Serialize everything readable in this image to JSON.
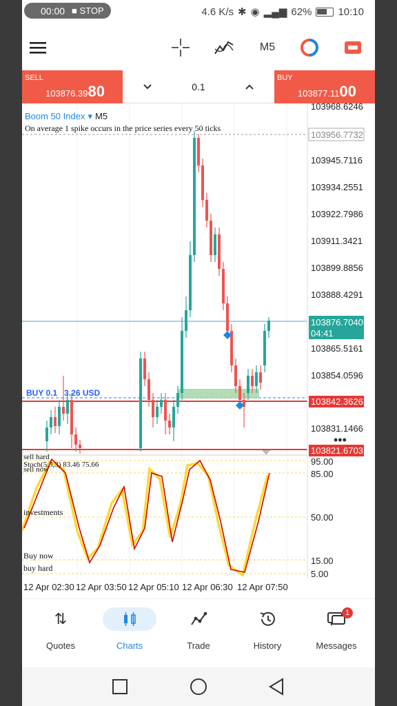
{
  "status_bar": {
    "rec_time": "00:00",
    "rec_stop": "STOP",
    "net_speed": "4.6 K/s",
    "icons": [
      "bluetooth-icon",
      "eye-icon",
      "alarm-icon",
      "signal-icon"
    ],
    "battery": "62%",
    "clock": "10:10"
  },
  "toolbar": {
    "menu_icon": "hamburger-menu-icon",
    "crosshair_icon": "crosshair-icon",
    "indicators_icon": "indicators-icon",
    "timeframe": "M5",
    "theme_icon": "color-theme-icon",
    "trade_icon": "trade-panel-icon"
  },
  "trade": {
    "sell_label": "SELL",
    "sell_price_small": "103876.39",
    "sell_price_big": "80",
    "lot": "0.1",
    "buy_label": "BUY",
    "buy_price_small": "103877.11",
    "buy_price_big": "00"
  },
  "chart": {
    "symbol": "Boom 50 Index",
    "symbol_arrow": "▾",
    "timeframe": "M5",
    "description": "On average 1 spike occurs in the price series every 50 ticks",
    "price_labels": [
      "103968.6246",
      "103945.7116",
      "103934.2551",
      "103922.7986",
      "103911.3421",
      "103899.8856",
      "103888.4291",
      "103865.5161",
      "103854.0596",
      "103831.1466"
    ],
    "boxed_top_label": "103956.7732",
    "current_price": "103876.7040",
    "countdown": "04:41",
    "red_level_1": "103842.3626",
    "red_level_2": "103821.6703",
    "position_label": "BUY 0.1",
    "position_pl": "3.26 USD",
    "stoch_title": "Stoch(5,3,3) 83.46 75.66",
    "stoch_levels": [
      "95.00",
      "85.00",
      "50.00",
      "15.00",
      "5.00"
    ],
    "zone_labels": {
      "sell_hard": "sell hard",
      "sell_now": "sell now",
      "investments": "investments",
      "buy_now": "Buy now",
      "buy_hard": "buy hard"
    },
    "time_labels": [
      "12 Apr 02:30",
      "12 Apr 03:50",
      "12 Apr 05:10",
      "12 Apr 06:30",
      "12 Apr 07:50"
    ],
    "colors": {
      "bull": "#26a69a",
      "bear": "#ef5350",
      "stoch_main": "#d50000",
      "stoch_signal": "#fdd835",
      "accent": "#1e88e5",
      "sell_buy": "#f15a47"
    }
  },
  "nav": {
    "quotes": "Quotes",
    "charts": "Charts",
    "trade": "Trade",
    "history": "History",
    "messages": "Messages",
    "messages_badge": "1"
  }
}
